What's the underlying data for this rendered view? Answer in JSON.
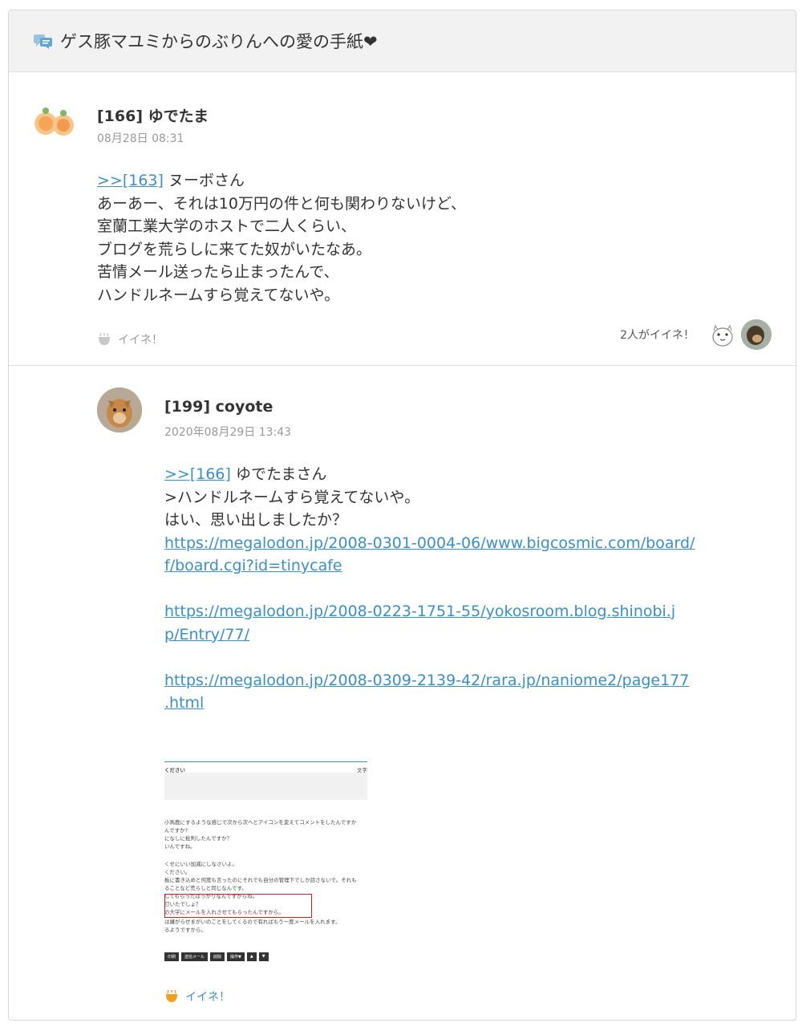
{
  "header": {
    "title": "ゲス豚マユミからのぶりんへの愛の手紙❤",
    "icon": "chat-bubbles-icon"
  },
  "posts": [
    {
      "name": "[166] ゆでたま",
      "date": "08月28日 08:31",
      "reply_link": ">>[163]",
      "reply_to": " ヌーボさん",
      "lines": [
        "あーあー、それは10万円の件と何も関わりないけど、",
        "室蘭工業大学のホストで二人くらい、",
        "ブログを荒らしに来てた奴がいたなあ。",
        "苦情メール送ったら止まったんで、",
        "ハンドルネームすら覚えてないや。"
      ],
      "like_label": "イイネ！",
      "likers_label": "2人がイイネ！"
    },
    {
      "name": "[199] coyote",
      "date": "2020年08月29日 13:43",
      "reply_link": ">>[166]",
      "reply_to": " ゆでたまさん",
      "lines": [
        ">ハンドルネームすら覚えてないや。",
        "はい、思い出しましたか？"
      ],
      "links": [
        [
          "https://megalodon.jp/2008-0301-0004-06/www.bigcosmic.com/board/",
          "f/board.cgi?id=tinycafe"
        ],
        [
          "https://megalodon.jp/2008-0223-1751-55/yokosroom.blog.shinobi.j",
          "p/Entry/77/"
        ],
        [
          "https://megalodon.jp/2008-0309-2139-42/rara.jp/naniome2/page177",
          ".html"
        ]
      ],
      "like_label": "イイネ！"
    }
  ],
  "screenshot": {
    "title_left": "ください",
    "title_right": "文字",
    "lines": [
      "小馬鹿にするような感じで次から次へとアイコンを変えてコメントをしたんですか",
      "んですか?",
      "になしに批判したんですか？",
      "いんですね。",
      "",
      "くせにいい加減にしなさいよ。",
      "ください。",
      "板に書き込めと何度も言ったのにそれでも自分の管理下でしか話さないで。それも",
      "ることなど荒らしと同じなんです。",
      "してもらったばっかりなんですからね。",
      "訂いたでしょ？",
      "の大学にメールを入れさせてもらったんですから。",
      "は嫌がらせまがいのことをしてくるので有ればもう一度メールを入れます。",
      "るようですから。"
    ],
    "buttons": [
      "印刷",
      "送信メール",
      "削除",
      "操作▼",
      "▲",
      "▼"
    ]
  },
  "colors": {
    "link": "#3a8fc4",
    "like_active": "#f0a020",
    "like_inactive": "#bbbbbb"
  }
}
